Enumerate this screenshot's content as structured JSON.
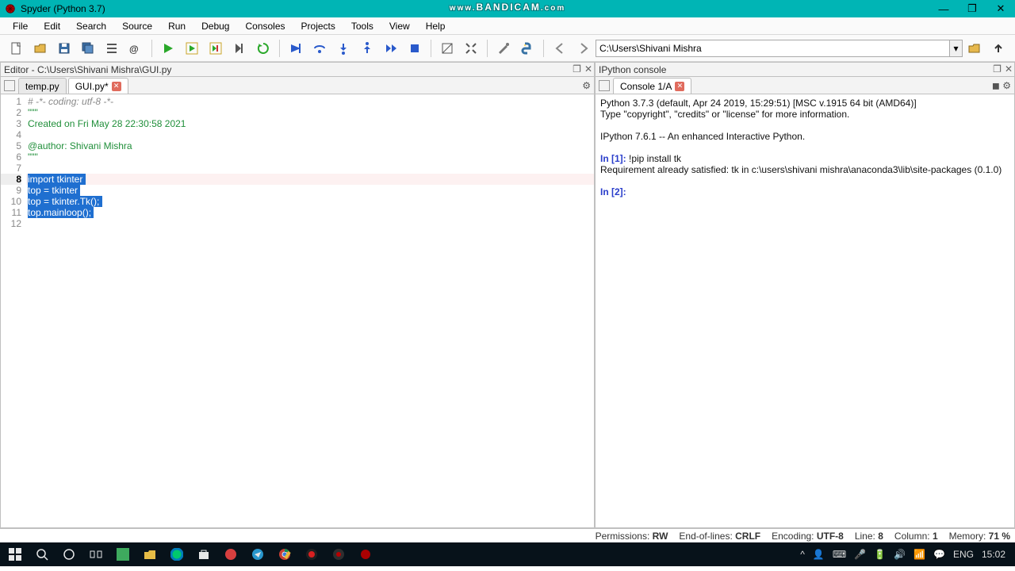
{
  "title": "Spyder (Python 3.7)",
  "watermark": {
    "prefix": "www.",
    "main": "BANDICAM",
    "suffix": ".com"
  },
  "win_controls": {
    "min": "—",
    "max": "❐",
    "close": "✕"
  },
  "menu": [
    "File",
    "Edit",
    "Search",
    "Source",
    "Run",
    "Debug",
    "Consoles",
    "Projects",
    "Tools",
    "View",
    "Help"
  ],
  "path": "C:\\Users\\Shivani Mishra",
  "editor": {
    "title": "Editor - C:\\Users\\Shivani Mishra\\GUI.py",
    "tabs": [
      {
        "label": "temp.py",
        "close": false
      },
      {
        "label": "GUI.py*",
        "close": true,
        "active": true
      }
    ],
    "lines": [
      {
        "n": 1,
        "seg": [
          {
            "t": "# -*- coding: utf-8 -*-",
            "cls": "c-comment"
          }
        ]
      },
      {
        "n": 2,
        "seg": [
          {
            "t": "\"\"\"",
            "cls": "c-str"
          }
        ]
      },
      {
        "n": 3,
        "seg": [
          {
            "t": "Created on Fri May 28 22:30:58 2021",
            "cls": "c-str"
          }
        ]
      },
      {
        "n": 4,
        "seg": [
          {
            "t": "",
            "cls": ""
          }
        ]
      },
      {
        "n": 5,
        "seg": [
          {
            "t": "@author: Shivani Mishra",
            "cls": "c-str"
          }
        ]
      },
      {
        "n": 6,
        "seg": [
          {
            "t": "\"\"\"",
            "cls": "c-str"
          }
        ]
      },
      {
        "n": 7,
        "seg": [
          {
            "t": "",
            "cls": ""
          }
        ]
      },
      {
        "n": 8,
        "seg": [
          {
            "t": "import tkinter ",
            "cls": "c-sel"
          }
        ],
        "current": true
      },
      {
        "n": 9,
        "seg": [
          {
            "t": "top = tkinter ",
            "cls": "c-sel"
          }
        ]
      },
      {
        "n": 10,
        "seg": [
          {
            "t": "top = tkinter.Tk(); ",
            "cls": "c-sel"
          }
        ]
      },
      {
        "n": 11,
        "seg": [
          {
            "t": "top.mainloop(); ",
            "cls": "c-sel"
          }
        ]
      },
      {
        "n": 12,
        "seg": [
          {
            "t": "",
            "cls": ""
          }
        ]
      }
    ]
  },
  "ipython": {
    "title": "IPython console",
    "tab": "Console 1/A",
    "out": [
      {
        "t": "Python 3.7.3 (default, Apr 24 2019, 15:29:51) [MSC v.1915 64 bit (AMD64)]"
      },
      {
        "t": "Type \"copyright\", \"credits\" or \"license\" for more information."
      },
      {
        "t": ""
      },
      {
        "t": "IPython 7.6.1 -- An enhanced Interactive Python."
      },
      {
        "t": ""
      },
      {
        "pr": "In [1]: ",
        "t": "!pip install tk"
      },
      {
        "t": "Requirement already satisfied: tk in c:\\users\\shivani mishra\\anaconda3\\lib\\site-packages (0.1.0)"
      },
      {
        "t": ""
      },
      {
        "pr": "In [2]: ",
        "t": ""
      }
    ]
  },
  "status": {
    "perm_l": "Permissions:",
    "perm_v": "RW",
    "eol_l": "End-of-lines:",
    "eol_v": "CRLF",
    "enc_l": "Encoding:",
    "enc_v": "UTF-8",
    "line_l": "Line:",
    "line_v": "8",
    "col_l": "Column:",
    "col_v": "1",
    "mem_l": "Memory:",
    "mem_v": "71 %"
  },
  "tray": {
    "lang": "ENG",
    "time": "15:02"
  }
}
